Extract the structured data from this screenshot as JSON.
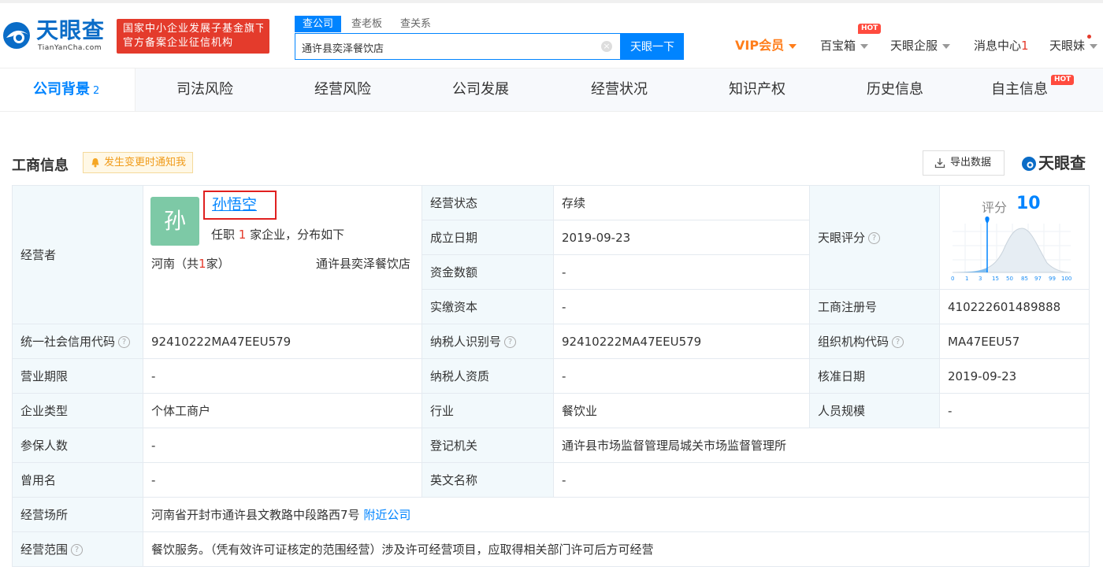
{
  "header": {
    "logo_cn": "天眼查",
    "logo_en": "TianYanCha.com",
    "fund_badge_line1": "国家中小企业发展子基金旗下",
    "fund_badge_line2": "官方备案企业征信机构",
    "search_tabs": [
      "查公司",
      "查老板",
      "查关系"
    ],
    "search_value": "通许县奕泽餐饮店",
    "search_button": "天眼一下",
    "nav": {
      "vip": "VIP会员",
      "treasure": "百宝箱",
      "hot_badge": "HOT",
      "enterprise": "天眼企服",
      "messages": "消息中心",
      "message_count": "1",
      "user": "天眼妹"
    }
  },
  "categories": [
    {
      "label": "公司背景",
      "count": "2"
    },
    {
      "label": "司法风险"
    },
    {
      "label": "经营风险"
    },
    {
      "label": "公司发展"
    },
    {
      "label": "经营状况"
    },
    {
      "label": "知识产权"
    },
    {
      "label": "历史信息"
    },
    {
      "label": "自主信息",
      "badge": "HOT"
    }
  ],
  "section": {
    "title": "工商信息",
    "notify": "发生变更时通知我",
    "export": "导出数据",
    "brand": "天眼查"
  },
  "operator": {
    "label": "经营者",
    "avatar_char": "孙",
    "name": "孙悟空",
    "sub_prefix": "任职",
    "sub_count": "1",
    "sub_suffix": "家企业，分布如下",
    "region_prefix": "河南（共",
    "region_count": "1",
    "region_suffix": "家）",
    "company": "通许县奕泽餐饮店"
  },
  "fields": {
    "status_label": "经营状态",
    "status_value": "存续",
    "founded_label": "成立日期",
    "founded_value": "2019-09-23",
    "capital_label": "资金数额",
    "capital_value": "-",
    "paid_label": "实缴资本",
    "paid_value": "-",
    "score_label": "天眼评分",
    "regno_label": "工商注册号",
    "regno_value": "410222601489888",
    "credit_label": "统一社会信用代码",
    "credit_value": "92410222MA47EEU579",
    "taxid_label": "纳税人识别号",
    "taxid_value": "92410222MA47EEU579",
    "org_label": "组织机构代码",
    "org_value": "MA47EEU57",
    "term_label": "营业期限",
    "term_value": "-",
    "taxqual_label": "纳税人资质",
    "taxqual_value": "-",
    "approve_label": "核准日期",
    "approve_value": "2019-09-23",
    "type_label": "企业类型",
    "type_value": "个体工商户",
    "industry_label": "行业",
    "industry_value": "餐饮业",
    "staff_label": "人员规模",
    "staff_value": "-",
    "insured_label": "参保人数",
    "insured_value": "-",
    "authority_label": "登记机关",
    "authority_value": "通许县市场监督管理局城关市场监督管理所",
    "former_label": "曾用名",
    "former_value": "-",
    "english_label": "英文名称",
    "english_value": "-",
    "address_label": "经营场所",
    "address_value": "河南省开封市通许县文教路中段路西7号",
    "nearby_link": "附近公司",
    "scope_label": "经营范围",
    "scope_value": "餐饮服务。（凭有效许可证核定的范围经营）涉及许可经营项目，应取得相关部门许可后方可经营"
  },
  "score": {
    "label": "评分",
    "value": "10",
    "ticks": [
      "0",
      "1",
      "3",
      "15",
      "50",
      "85",
      "97",
      "99",
      "100"
    ]
  },
  "colors": {
    "primary": "#0084ff",
    "vip": "#ff7d1a",
    "badge_red": "#e43b2c",
    "label_bg": "#f2f9fc",
    "avatar_bg": "#7dc9a6"
  }
}
